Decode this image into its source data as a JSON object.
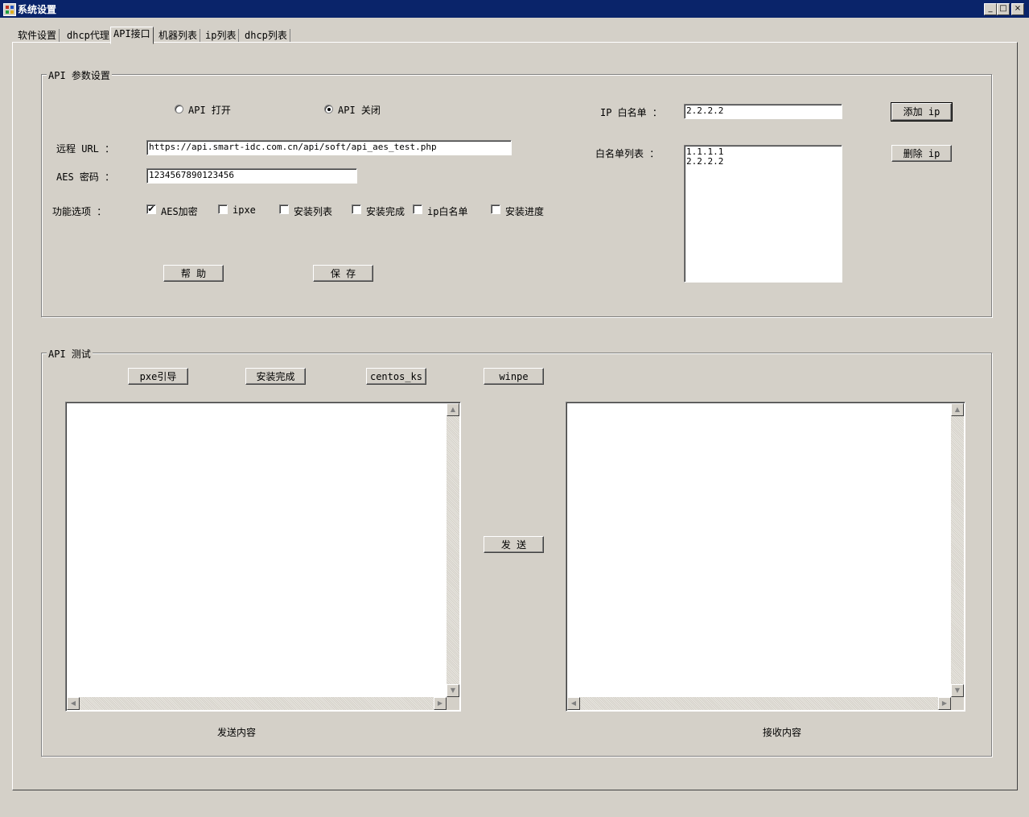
{
  "window": {
    "title": "系统设置",
    "minimize": "_",
    "maximize": "□",
    "close": "×"
  },
  "tabs": [
    {
      "label": "软件设置"
    },
    {
      "label": "dhcp代理"
    },
    {
      "label": "API接口"
    },
    {
      "label": "机器列表"
    },
    {
      "label": "ip列表"
    },
    {
      "label": "dhcp列表"
    }
  ],
  "active_tab": "API接口",
  "api_settings": {
    "legend": "API 参数设置",
    "radio_open": "API 打开",
    "radio_close": "API 关闭",
    "selected": "API 关闭",
    "url_label": "远程 URL ：",
    "url_value": "https://api.smart-idc.com.cn/api/soft/api_aes_test.php",
    "aes_label": "AES 密码 ：",
    "aes_value": "1234567890123456",
    "options_label": "功能选项 ：",
    "options": [
      {
        "label": "AES加密",
        "checked": true
      },
      {
        "label": "ipxe",
        "checked": false
      },
      {
        "label": "安装列表",
        "checked": false
      },
      {
        "label": "安装完成",
        "checked": false
      },
      {
        "label": "ip白名单",
        "checked": false
      },
      {
        "label": "安装进度",
        "checked": false
      }
    ],
    "help_button": "帮 助",
    "save_button": "保 存",
    "ip_whitelist_label": "IP 白名单 ：",
    "ip_whitelist_value": "2.2.2.2",
    "whitelist_list_label": "白名单列表 ：",
    "whitelist_items": [
      "1.1.1.1",
      "2.2.2.2"
    ],
    "add_ip_button": "添加 ip",
    "delete_ip_button": "删除 ip"
  },
  "api_test": {
    "legend": "API 测试",
    "buttons": [
      "pxe引导",
      "安装完成",
      "centos_ks",
      "winpe"
    ],
    "send_button": "发 送",
    "send_content_label": "发送内容",
    "receive_content_label": "接收内容",
    "send_content": "",
    "receive_content": ""
  },
  "icons": {
    "scroll_up": "▲",
    "scroll_down": "▼",
    "scroll_left": "◀",
    "scroll_right": "▶",
    "checkmark": "✔"
  }
}
